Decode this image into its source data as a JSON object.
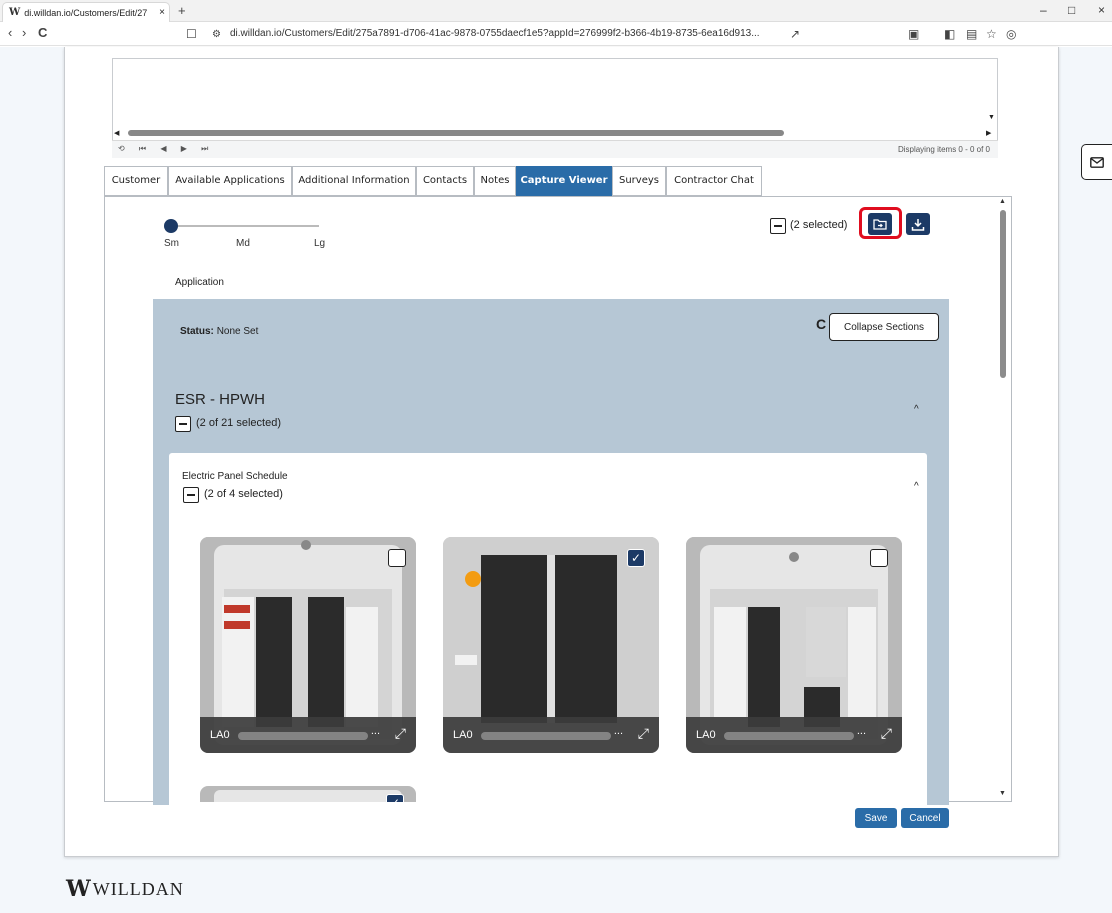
{
  "browser": {
    "tab_title": "di.willdan.io/Customers/Edit/27",
    "tab_favicon": "W",
    "tab_close": "×",
    "new_tab": "+",
    "url": "di.willdan.io/Customers/Edit/275a7891-d706-41ac-9878-0755daecf1e5?appId=276999f2-b366-4b19-8735-6ea16d913...",
    "back": "‹",
    "forward": "›",
    "reload": "C",
    "minimize": "–",
    "maximize": "□",
    "close": "×"
  },
  "grid": {
    "pager_icons": "⟲ ⏮ ◀ ▶ ⏭",
    "pager_text": "Displaying items 0 - 0 of 0"
  },
  "tabs": [
    "Customer",
    "Available Applications",
    "Additional Information",
    "Contacts",
    "Notes",
    "Capture Viewer",
    "Surveys",
    "Contractor Chat"
  ],
  "active_tab": "Capture Viewer",
  "viewer": {
    "size_labels": [
      "Sm",
      "Md",
      "Lg"
    ],
    "selected_size": "Sm",
    "selection_summary": "(2 selected)",
    "section_label": "Application",
    "status_label": "Status:",
    "status_value": "None Set",
    "collapse_button": "Collapse Sections",
    "refresh_icon": "C"
  },
  "section": {
    "title": "ESR - HPWH",
    "selection": "(2 of 21 selected)",
    "chevron": "^"
  },
  "subsection": {
    "title": "Electric Panel Schedule",
    "selection": "(2 of 4 selected)",
    "chevron": "^"
  },
  "photos": [
    {
      "label": "LA0",
      "checked": false
    },
    {
      "label": "LA0",
      "checked": true
    },
    {
      "label": "LA0",
      "checked": false
    },
    {
      "label": "",
      "checked": true
    }
  ],
  "photo_more": "...",
  "photo_expand": "⤢",
  "check_mark": "✓",
  "footer": {
    "save": "Save",
    "cancel": "Cancel"
  },
  "brand": {
    "mark": "W",
    "name": "WILLDAN"
  },
  "colors": {
    "accent": "#2a6ca8",
    "navy": "#1c3a66",
    "highlight": "#e00d1f",
    "section_bg": "#b6c7d5"
  }
}
